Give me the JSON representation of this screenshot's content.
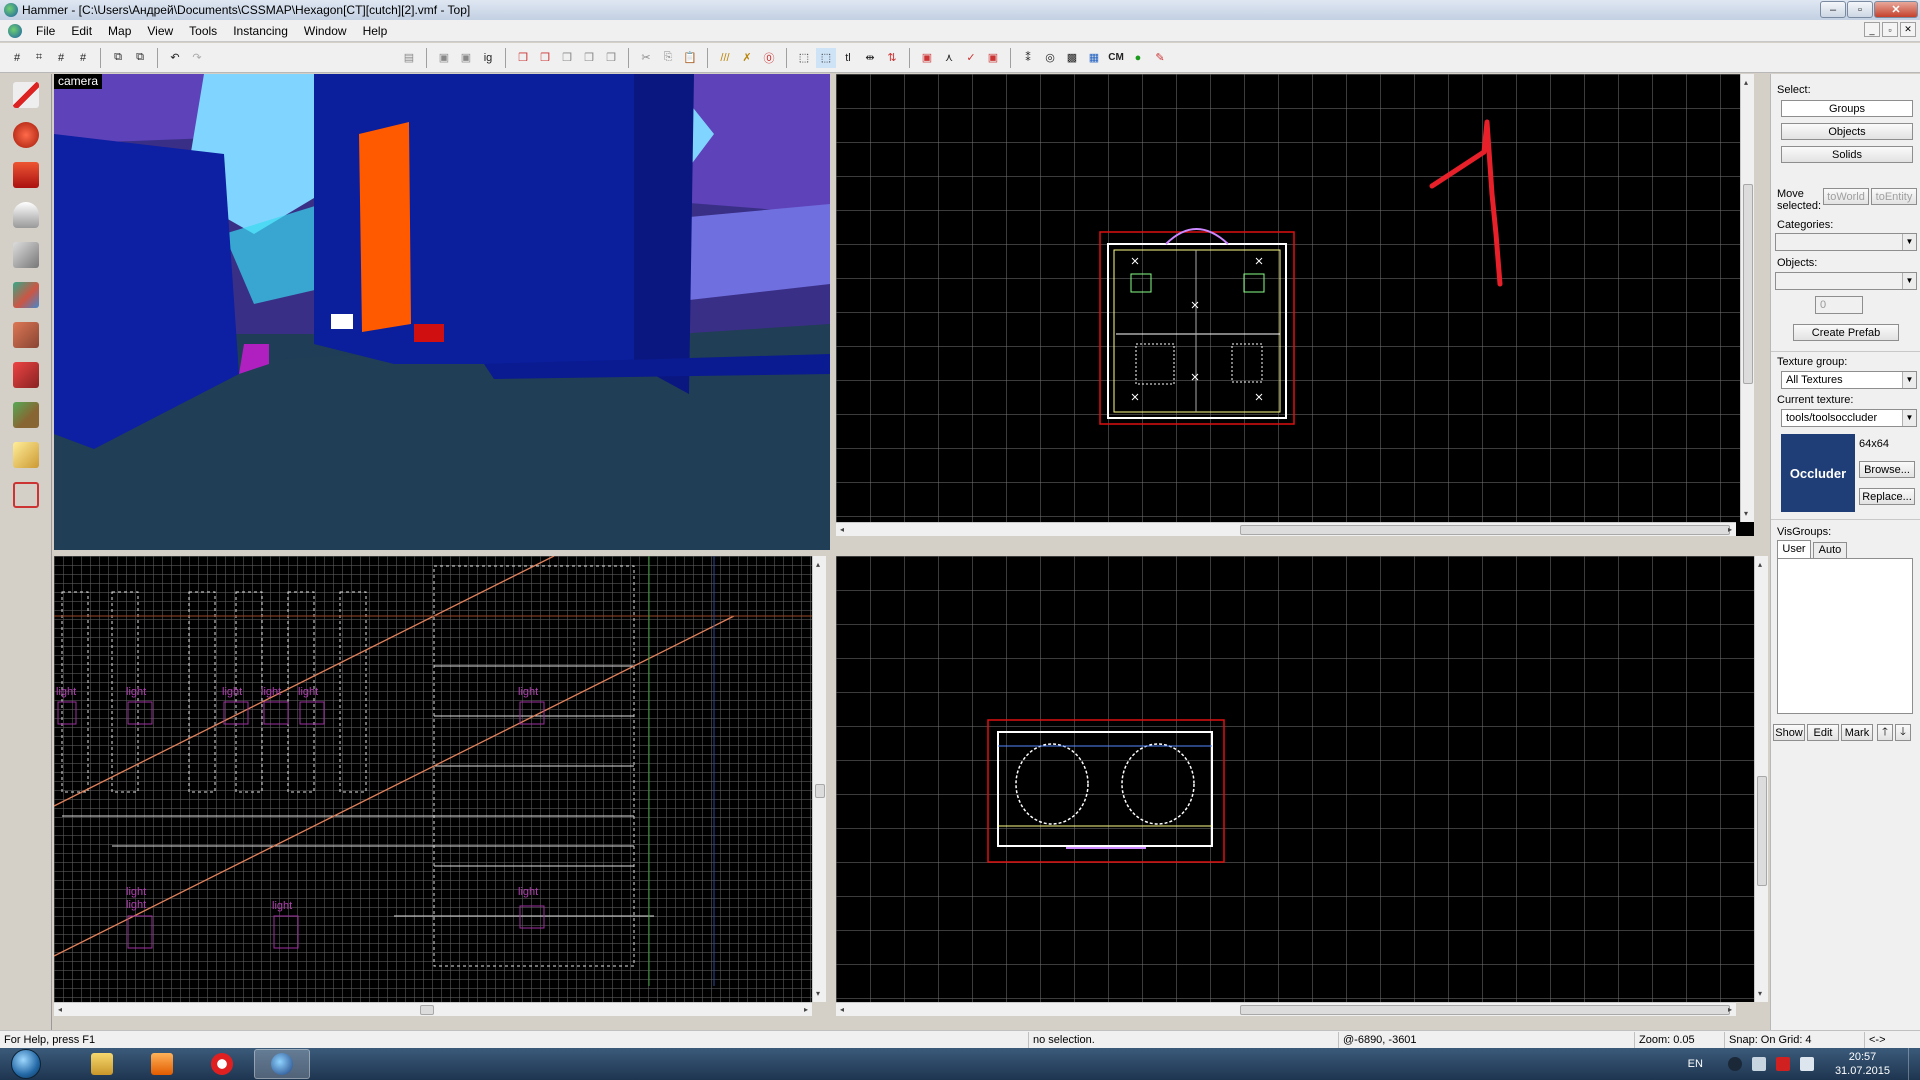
{
  "window": {
    "title": "Hammer - [C:\\Users\\Андрей\\Documents\\CSSMAP\\Hexagon[CT][cutch][2].vmf - Top]",
    "controls": {
      "minimize": "‒",
      "maximize": "▫",
      "close": "✕"
    }
  },
  "menu": {
    "items": [
      "File",
      "Edit",
      "Map",
      "View",
      "Tools",
      "Instancing",
      "Window",
      "Help"
    ],
    "mdi_controls": {
      "minimize": "_",
      "restore": "▫",
      "close": "✕"
    }
  },
  "toolbar": {
    "cm_label": "CM"
  },
  "viewports": {
    "camera": {
      "label": "camera"
    },
    "light_labels": [
      "light",
      "light",
      "light",
      "light",
      "light",
      "light",
      "light",
      "light",
      "light",
      "light"
    ]
  },
  "panel": {
    "select_label": "Select:",
    "groups": "Groups",
    "objects": "Objects",
    "solids": "Solids",
    "move_selected": "Move selected:",
    "to_world": "toWorld",
    "to_entity": "toEntity",
    "categories_label": "Categories:",
    "objects_label": "Objects:",
    "spin_value": "0",
    "create_prefab": "Create Prefab",
    "texture_group_label": "Texture group:",
    "texture_group_value": "All Textures",
    "current_texture_label": "Current texture:",
    "current_texture_value": "tools/toolsoccluder",
    "texture_size": "64x64",
    "texture_preview_text": "Occluder",
    "browse": "Browse...",
    "replace": "Replace...",
    "visgroups_label": "VisGroups:",
    "tab_user": "User",
    "tab_auto": "Auto",
    "show": "Show",
    "edit": "Edit",
    "mark": "Mark",
    "up_arrow": "🡑",
    "down_arrow": "🡓"
  },
  "status": {
    "help": "For Help, press F1",
    "selection": "no selection.",
    "coords": "@-6890, -3601",
    "zoom": "Zoom: 0.05",
    "snap": "Snap: On Grid: 4",
    "extra": "<->"
  },
  "taskbar": {
    "lang": "EN",
    "time": "20:57",
    "date": "31.07.2015"
  },
  "colors": {
    "accent_red": "#e8202a",
    "brand_orange": "#ff5a00",
    "occluder_blue": "#1f3d77"
  }
}
